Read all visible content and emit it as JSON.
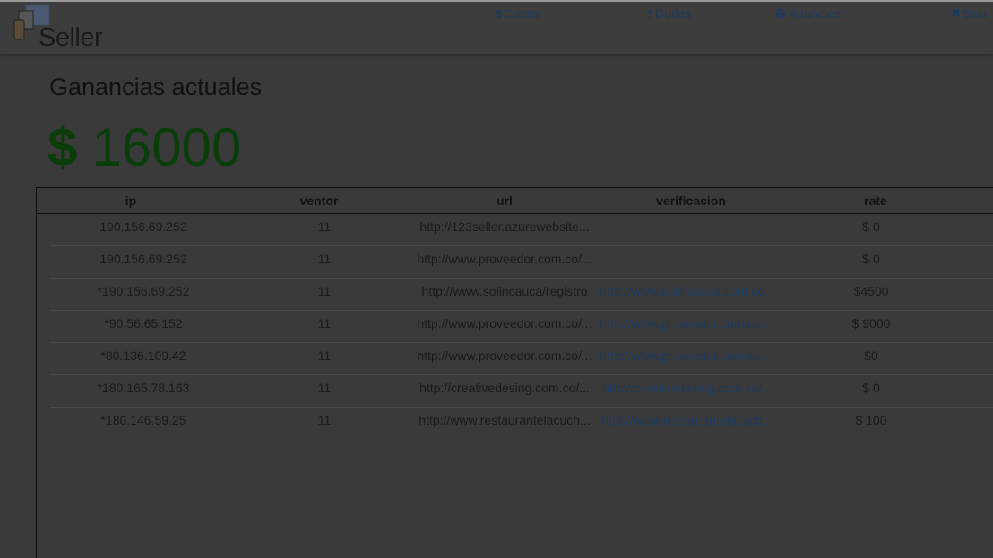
{
  "app": {
    "logo_text": "Seller"
  },
  "nav": {
    "cobrar": {
      "icon": "dollar-icon",
      "label": "Cobrar"
    },
    "dudas": {
      "icon": "question-icon",
      "label": "Dudas"
    },
    "anuncios": {
      "icon": "globe-icon",
      "label": "Anuncios"
    },
    "salir": {
      "icon": "close-icon",
      "label": "Salir"
    }
  },
  "main": {
    "title": "Ganancias actuales",
    "currency": "$",
    "amount": "16000"
  },
  "table": {
    "headers": [
      "ip",
      "ventor",
      "url",
      "verificacion",
      "rate"
    ],
    "rows": [
      {
        "ip": "190.156.69.252",
        "ventor": "11",
        "url": "http://123seller.azurewebsite...",
        "verificacion": "",
        "rate": "$ 0"
      },
      {
        "ip": "190.156.69.252",
        "ventor": "11",
        "url": "http://www.proveedor.com.co/...",
        "verificacion": "",
        "rate": "$ 0"
      },
      {
        "ip": "*190.156.69.252",
        "ventor": "11",
        "url": "http://www.solincauca/registro",
        "verificacion": "http://www.solincauca.com.co...",
        "rate": "$4500"
      },
      {
        "ip": "*90.56.65.152",
        "ventor": "11",
        "url": "http://www.proveedor.com.co/...",
        "verificacion": "http://www.proveedor.com.co/...",
        "rate": "$ 9000"
      },
      {
        "ip": "*80.136.109.42",
        "ventor": "11",
        "url": "http://www.proveedor.com.co/...",
        "verificacion": "http://www.proveedor.com.co/...",
        "rate": "$0"
      },
      {
        "ip": "*180.165.78.163",
        "ventor": "11",
        "url": "http://creativedesing.com.co/...",
        "verificacion": "http://creativedesing.com.co/...",
        "rate": "$ 0"
      },
      {
        "ip": "*180.146.59.25",
        "ventor": "11",
        "url": "http://www.restaurantelacuch...",
        "verificacion": "http://www.restaurantelacuch...",
        "rate": "$ 100"
      }
    ]
  },
  "colors": {
    "background": "#3a3a3a",
    "link": "#1d3a5c",
    "earnings": "#0b3d0b"
  }
}
